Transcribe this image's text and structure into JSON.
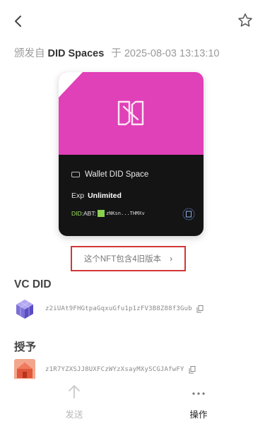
{
  "header": {
    "back_icon": "back-chevron-icon",
    "favorite_icon": "star-outline-icon"
  },
  "issued": {
    "prefix": "颁发自",
    "issuer": "DID Spaces",
    "date_prefix": "于",
    "date": "2025-08-03 13:13:10"
  },
  "card": {
    "accent_color": "#e040b8",
    "logo_icon": "did-spaces-logo-icon",
    "title": "Wallet DID Space",
    "exp_label": "Exp",
    "exp_value": "Unlimited",
    "did_label": "DID",
    "did_mid": ":ABT:",
    "did_address": "zNKsn...THMXv",
    "seal_icon": "did-seal-icon"
  },
  "versions_button": {
    "label": "这个NFT包含4旧版本",
    "chevron": "›",
    "highlight_color": "#d23636"
  },
  "vc_did": {
    "title": "VC DID",
    "address": "z2iUAt9FHGtpaGqxuGfu1p1zFV3B8Z88f3Gub",
    "avatar_icon": "purple-cube-avatar-icon",
    "copy_icon": "copy-icon"
  },
  "grant": {
    "title": "授予",
    "address": "z1R7YZXSJJ8UXFCzWYzXsayMXySCGJAfwFY",
    "avatar_icon": "red-house-avatar-icon",
    "copy_icon": "copy-icon"
  },
  "bottom_actions": {
    "send_label": "发送",
    "send_icon": "arrow-up-icon",
    "ops_label": "操作",
    "ops_icon": "more-dots-icon"
  }
}
